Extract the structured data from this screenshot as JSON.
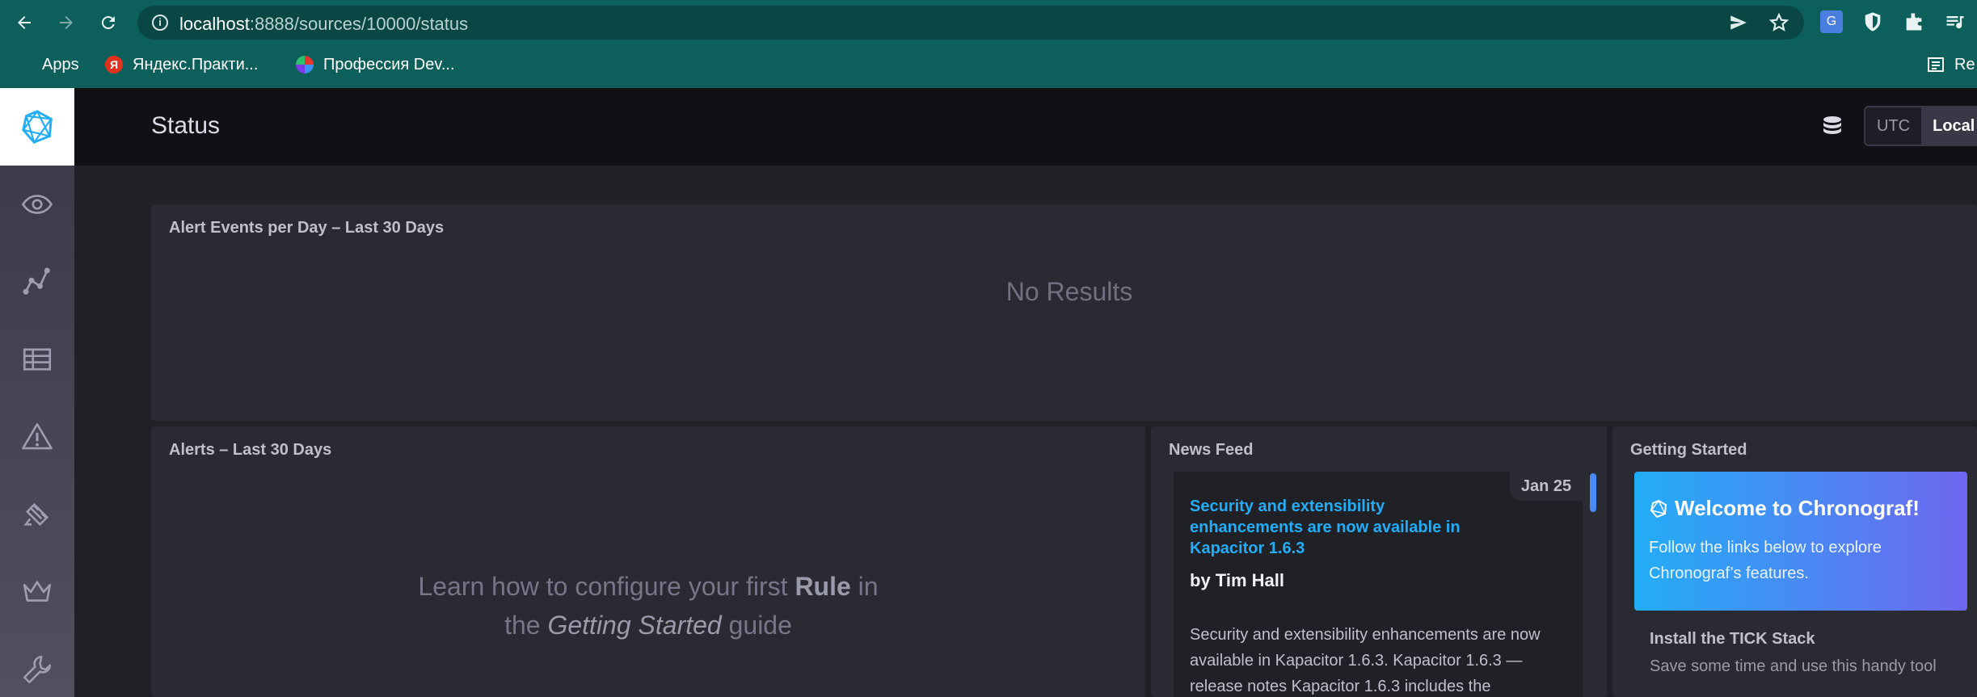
{
  "browser": {
    "url_host": "localhost",
    "url_path": ":8888/sources/10000/status",
    "bookmarks": [
      {
        "label": "Apps"
      },
      {
        "label": "Яндекс.Практи..."
      },
      {
        "label": "Профессия Dev..."
      }
    ],
    "reading_list_label": "Re",
    "icons": {
      "back": "arrow-left-icon",
      "forward": "arrow-right-icon",
      "reload": "reload-icon",
      "send": "send-icon",
      "bookmark": "star-icon"
    }
  },
  "header": {
    "title": "Status",
    "timezone": {
      "utc_label": "UTC",
      "local_label": "Local",
      "selected": "Local"
    }
  },
  "sidebar": {
    "items": [
      {
        "icon": "chronograf-logo-icon"
      },
      {
        "icon": "eye-icon"
      },
      {
        "icon": "graph-icon"
      },
      {
        "icon": "dashboards-icon"
      },
      {
        "icon": "alert-triangle-icon"
      },
      {
        "icon": "kapacitor-icon"
      },
      {
        "icon": "crown-icon"
      },
      {
        "icon": "wrench-icon"
      }
    ]
  },
  "alert_events": {
    "title": "Alert Events per Day – Last 30 Days",
    "empty_text": "No Results"
  },
  "alerts": {
    "title": "Alerts – Last 30 Days",
    "empty_line1_pre": "Learn how to configure your first ",
    "empty_line1_bold": "Rule",
    "empty_line1_post": " in",
    "empty_line2_pre": "the ",
    "empty_line2_italic": "Getting Started",
    "empty_line2_post": " guide"
  },
  "news_feed": {
    "title": "News Feed",
    "item": {
      "date": "Jan 25",
      "headline": "Security and extensibility enhancements are now available in Kapacitor 1.6.3",
      "author": "by Tim Hall",
      "body": "Security and extensibility enhancements are now available in Kapacitor 1.6.3. Kapacitor 1.6.3 — release notes Kapacitor 1.6.3 includes the"
    }
  },
  "getting_started": {
    "title": "Getting Started",
    "welcome_title": "Welcome to Chronograf!",
    "welcome_text": "Follow the links below to explore Chronograf’s features.",
    "install_title": "Install the TICK Stack",
    "install_text": "Save some time and use this handy tool"
  },
  "colors": {
    "accent_blue": "#22adf6",
    "accent_purple": "#6f67f0",
    "browser_teal": "#0c5f5b"
  }
}
